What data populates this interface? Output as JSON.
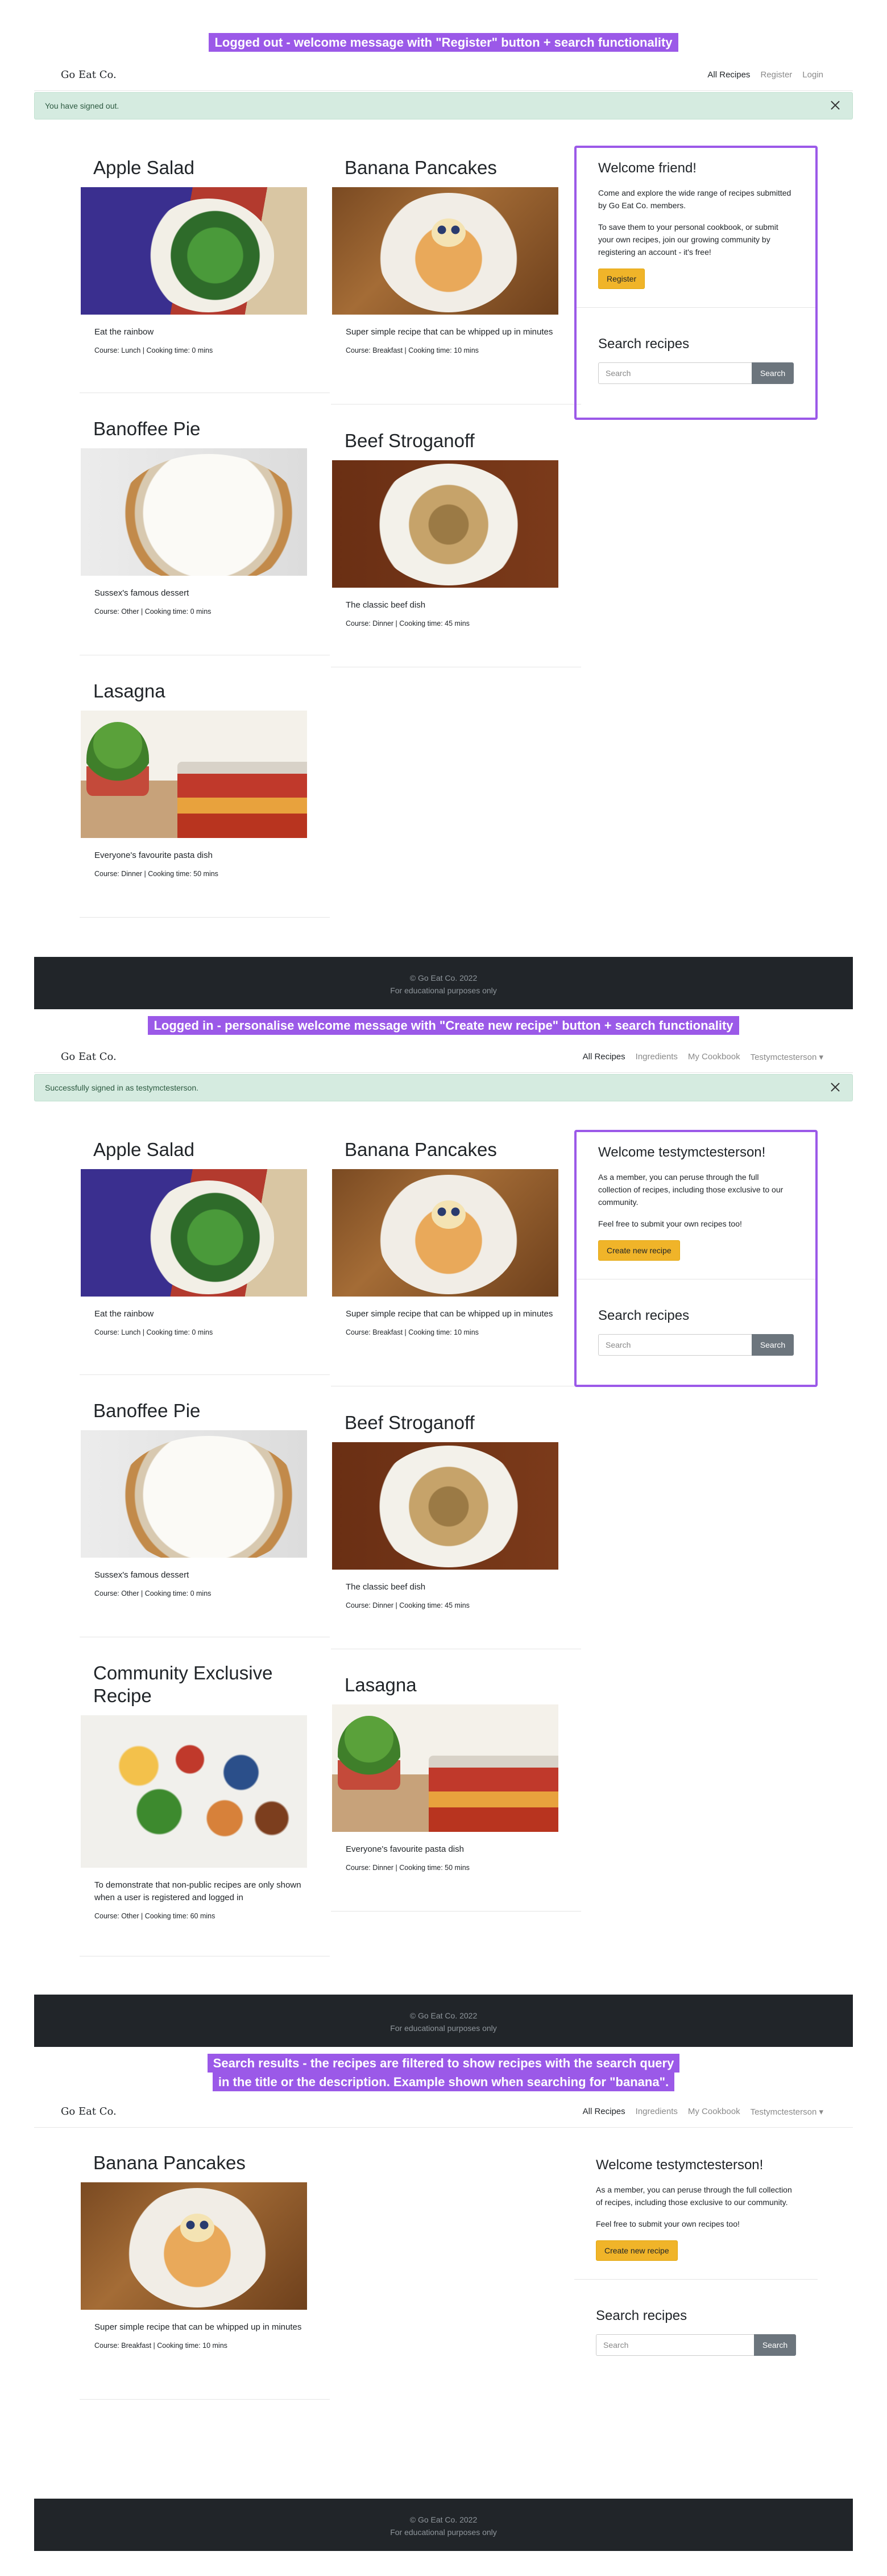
{
  "captions": {
    "panel1": "Logged out - welcome message with \"Register\" button + search functionality",
    "panel2": "Logged in - personalise welcome message with \"Create new recipe\" button + search functionality",
    "panel3_line1": "Search results - the recipes are filtered to show recipes with the search query",
    "panel3_line2": "in the title or the description. Example shown when searching for \"banana\"."
  },
  "brand": "Go Eat Co.",
  "nav_logged_out": {
    "all_recipes": "All Recipes",
    "register": "Register",
    "login": "Login"
  },
  "nav_logged_in": {
    "all_recipes": "All Recipes",
    "ingredients": "Ingredients",
    "my_cookbook": "My Cookbook",
    "user": "Testymctesterson ▾"
  },
  "alerts": {
    "signed_out": "You have signed out.",
    "signed_in": "Successfully signed in as testymctesterson."
  },
  "recipes": {
    "apple_salad": {
      "title": "Apple Salad",
      "desc": "Eat the rainbow",
      "meta": "Course: Lunch | Cooking time: 0 mins"
    },
    "banana_pancakes": {
      "title": "Banana Pancakes",
      "desc": "Super simple recipe that can be whipped up in minutes",
      "meta": "Course: Breakfast | Cooking time: 10 mins"
    },
    "banoffee_pie": {
      "title": "Banoffee Pie",
      "desc": "Sussex's famous dessert",
      "meta": "Course: Other | Cooking time: 0 mins"
    },
    "beef_stroganoff": {
      "title": "Beef Stroganoff",
      "desc": "The classic beef dish",
      "meta": "Course: Dinner | Cooking time: 45 mins"
    },
    "lasagna": {
      "title": "Lasagna",
      "desc": "Everyone's favourite pasta dish",
      "meta": "Course: Dinner | Cooking time: 50 mins"
    },
    "community": {
      "title": "Community Exclusive Recipe",
      "desc": "To demonstrate that non-public recipes are only shown when a user is registered and logged in",
      "meta": "Course: Other | Cooking time: 60 mins"
    }
  },
  "sidebar_logged_out": {
    "heading": "Welcome friend!",
    "p1": "Come and explore the wide range of recipes submitted by Go Eat Co. members.",
    "p2": "To save them to your personal cookbook, or submit your own recipes, join our growing community by registering an account - it's free!",
    "button": "Register"
  },
  "sidebar_logged_in": {
    "heading": "Welcome testymctesterson!",
    "p1": "As a member, you can peruse through the full collection of recipes, including those exclusive to our community.",
    "p2": "Feel free to submit your own recipes too!",
    "button": "Create new recipe"
  },
  "search": {
    "heading": "Search recipes",
    "placeholder": "Search",
    "button": "Search"
  },
  "footer": {
    "line1": "© Go Eat Co. 2022",
    "line2": "For educational purposes only"
  },
  "colors": {
    "accent_purple": "#9b59e8",
    "button_yellow": "#f0b429",
    "footer_dark": "#212529",
    "alert_green": "#d5ebe0"
  }
}
